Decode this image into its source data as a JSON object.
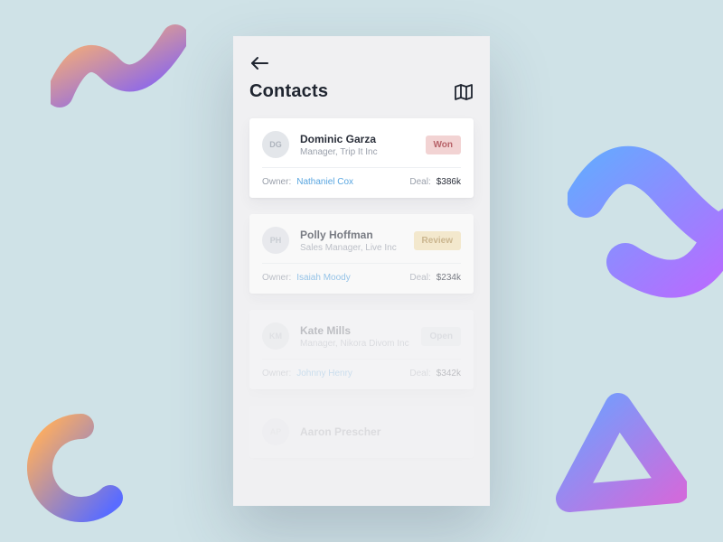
{
  "header": {
    "title": "Contacts"
  },
  "labels": {
    "owner": "Owner:",
    "deal": "Deal:"
  },
  "contacts": [
    {
      "initials": "DG",
      "name": "Dominic Garza",
      "role": "Manager, Trip It Inc",
      "status": "Won",
      "status_kind": "won",
      "owner": "Nathaniel Cox",
      "deal": "$386k"
    },
    {
      "initials": "PH",
      "name": "Polly Hoffman",
      "role": "Sales Manager, Live Inc",
      "status": "Review",
      "status_kind": "review",
      "owner": "Isaiah Moody",
      "deal": "$234k"
    },
    {
      "initials": "KM",
      "name": "Kate Mills",
      "role": "Manager, Nikora Divom Inc",
      "status": "Open",
      "status_kind": "open",
      "owner": "Johnny Henry",
      "deal": "$342k"
    },
    {
      "initials": "AP",
      "name": "Aaron Prescher",
      "role": "",
      "status": "",
      "status_kind": "",
      "owner": "",
      "deal": ""
    }
  ]
}
